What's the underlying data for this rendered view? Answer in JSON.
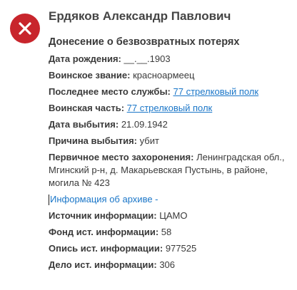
{
  "person": {
    "name": "Ердяков Александр Павлович",
    "report_title": "Донесение о безвозвратных потерях"
  },
  "fields": [
    {
      "label": "Дата рождения:",
      "value": "__.__.1903",
      "link": false
    },
    {
      "label": "Воинское звание:",
      "value": "красноармеец",
      "link": false
    },
    {
      "label": "Последнее место службы:",
      "value": "77 стрелковый полк",
      "link": true
    },
    {
      "label": "Воинская часть:",
      "value": "77 стрелковый полк",
      "link": true
    },
    {
      "label": "Дата выбытия:",
      "value": "21.09.1942",
      "link": false
    },
    {
      "label": "Причина выбытия:",
      "value": "убит",
      "link": false
    },
    {
      "label": "Первичное место захоронения:",
      "value": "Ленинградская обл., Мгинский р-н, д. Макарьевская Пустынь, в районе, могила № 423",
      "link": false
    }
  ],
  "archive_toggle": "Информация об архиве -",
  "archive_fields": [
    {
      "label": "Источник информации:",
      "value": "ЦАМО"
    },
    {
      "label": "Фонд ист. информации:",
      "value": "58"
    },
    {
      "label": "Опись ист. информации:",
      "value": "977525"
    },
    {
      "label": "Дело ист. информации:",
      "value": "306"
    }
  ],
  "colors": {
    "icon_bg": "#c8252c",
    "link": "#1a76c8"
  },
  "icons": {
    "status": "close-icon"
  }
}
